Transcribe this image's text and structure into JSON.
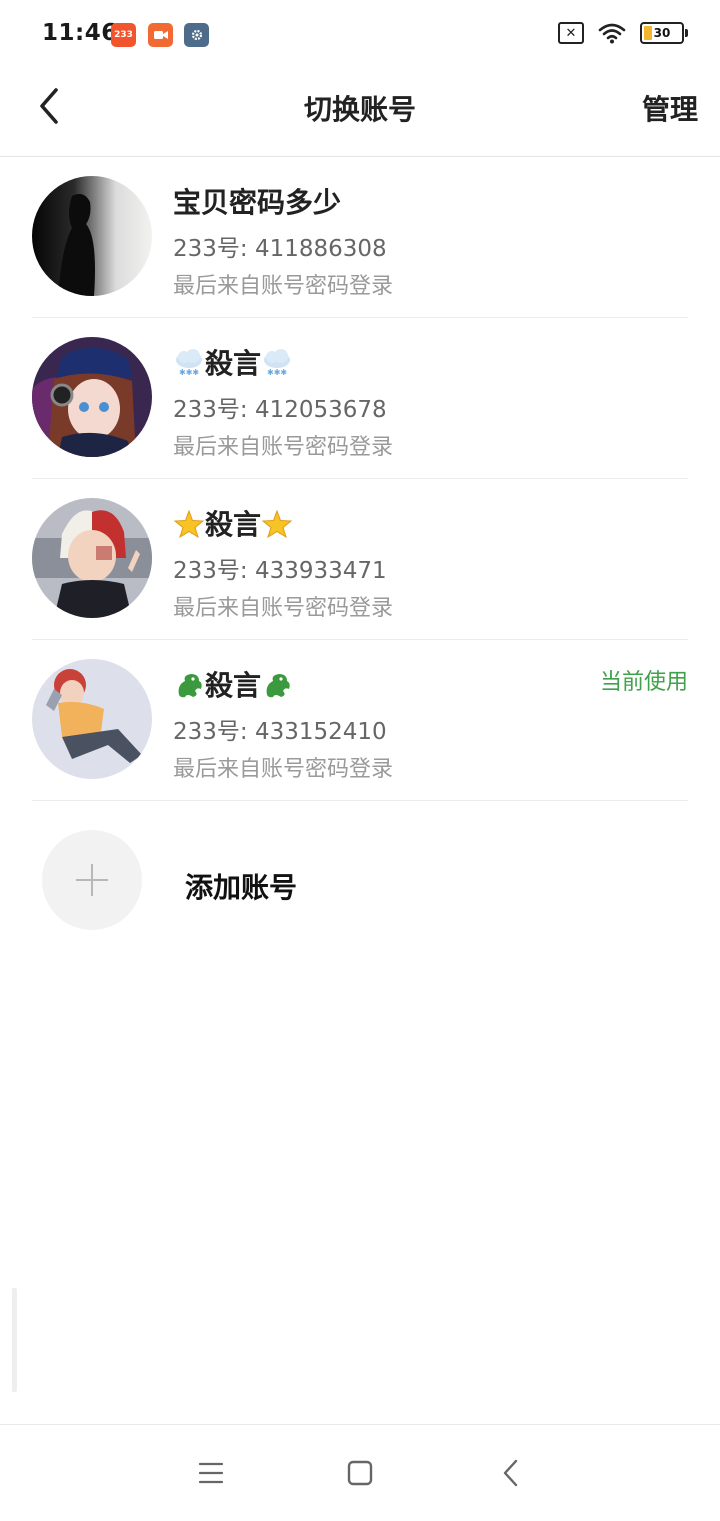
{
  "status_bar": {
    "time": "11:46",
    "apps": [
      {
        "icon": "233-app-icon",
        "label": "233",
        "color": "#f2542d"
      },
      {
        "icon": "video-app-icon",
        "color": "#f26a33"
      },
      {
        "icon": "settings-app-icon",
        "color": "#4d6b8a"
      }
    ],
    "battery_level": "30",
    "battery_color": "#f2b632"
  },
  "header": {
    "title": "切换账号",
    "manage_label": "管理"
  },
  "accounts": [
    {
      "name": "宝贝密码多少",
      "emoji": "",
      "id_text": "233号: 411886308",
      "login_note": "最后来自账号密码登录",
      "current": false,
      "avatar": "silhouette-avatar"
    },
    {
      "name": "殺言",
      "emoji": "snow-cloud-icon",
      "id_text": "233号: 412053678",
      "login_note": "最后来自账号密码登录",
      "current": false,
      "avatar": "anime-girl-avatar"
    },
    {
      "name": "殺言",
      "emoji": "star-icon",
      "id_text": "233号: 433933471",
      "login_note": "最后来自账号密码登录",
      "current": false,
      "avatar": "anime-boy-avatar"
    },
    {
      "name": "殺言",
      "emoji": "dragon-icon",
      "id_text": "233号: 433152410",
      "login_note": "最后来自账号密码登录",
      "current": true,
      "badge": "当前使用",
      "avatar": "anime-reclining-avatar"
    }
  ],
  "add_account": {
    "label": "添加账号"
  },
  "colors": {
    "accent_green": "#3fa14a",
    "divider": "#ececec"
  }
}
